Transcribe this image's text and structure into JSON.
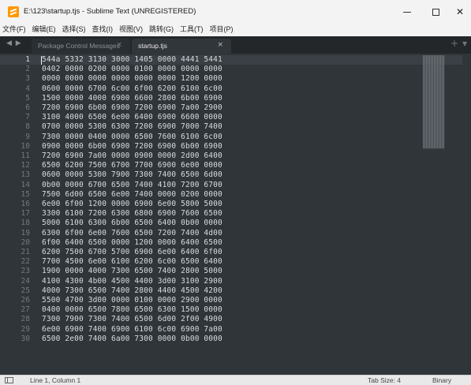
{
  "window": {
    "title": "E:\\123\\startup.tjs - Sublime Text (UNREGISTERED)",
    "minimize_glyph": "",
    "maximize_glyph": "",
    "close_glyph": "✕"
  },
  "menu": [
    "文件(F)",
    "编辑(E)",
    "选择(S)",
    "查找(I)",
    "视图(V)",
    "跳转(G)",
    "工具(T)",
    "项目(P)"
  ],
  "tabs": {
    "nav_arrows": "◀ ▶",
    "items": [
      {
        "label": "Package Control Messages",
        "close": "×",
        "active": false
      },
      {
        "label": "startup.tjs",
        "close": "×",
        "active": true
      }
    ],
    "new_tab": "+",
    "dropdown": "▼"
  },
  "editor": {
    "current_line": 1,
    "lines": [
      "544a 5332 3130 3000 1405 0000 4441 5441",
      "0402 0000 0200 0000 0100 0000 0000 0000",
      "0000 0000 0000 0000 0000 0000 1200 0000",
      "0600 0000 6700 6c00 6f00 6200 6100 6c00",
      "1500 0000 4000 6900 6600 2800 6b00 6900",
      "7200 6900 6b00 6900 7200 6900 7a00 2900",
      "3100 4000 6500 6e00 6400 6900 6600 0000",
      "0700 0000 5300 6300 7200 6900 7000 7400",
      "7300 0000 0400 0000 6500 7600 6100 6c00",
      "0900 0000 6b00 6900 7200 6900 6b00 6900",
      "7200 6900 7a00 0000 0900 0000 2d00 6400",
      "6500 6200 7500 6700 7700 6900 6e00 0000",
      "0600 0000 5300 7900 7300 7400 6500 6d00",
      "0b00 0000 6700 6500 7400 4100 7200 6700",
      "7500 6d00 6500 6e00 7400 0000 0200 0000",
      "6e00 6f00 1200 0000 6900 6e00 5800 5000",
      "3300 6100 7200 6300 6800 6900 7600 6500",
      "5000 6100 6300 6b00 6500 6400 0b00 0000",
      "6300 6f00 6e00 7600 6500 7200 7400 4d00",
      "6f00 6400 6500 0000 1200 0000 6400 6500",
      "6200 7500 6700 5700 6900 6e00 6400 6f00",
      "7700 4500 6e00 6100 6200 6c00 6500 6400",
      "1900 0000 4000 7300 6500 7400 2800 5000",
      "4100 4300 4b00 4500 4400 3d00 3100 2900",
      "4000 7300 6500 7400 2800 4400 4500 4200",
      "5500 4700 3d00 0000 0100 0000 2900 0000",
      "0400 0000 6500 7800 6500 6300 1500 0000",
      "7300 7900 7300 7400 6500 6d00 2f00 4900",
      "6e00 6900 7400 6900 6100 6c00 6900 7a00",
      "6500 2e00 7400 6a00 7300 0000 0b00 0000"
    ]
  },
  "status": {
    "position": "Line 1, Column 1",
    "tab_size": "Tab Size: 4",
    "syntax": "Binary"
  },
  "colors": {
    "editor_bg": "#303539",
    "tabbar_bg": "#23272a",
    "active_tab_bg": "#31363a",
    "text": "#d8dcde",
    "gutter_text": "#6f7a80",
    "app_icon": "#ff9800"
  },
  "icons": {
    "app": "sublime-logo-icon",
    "panel": "side-panel-icon"
  }
}
